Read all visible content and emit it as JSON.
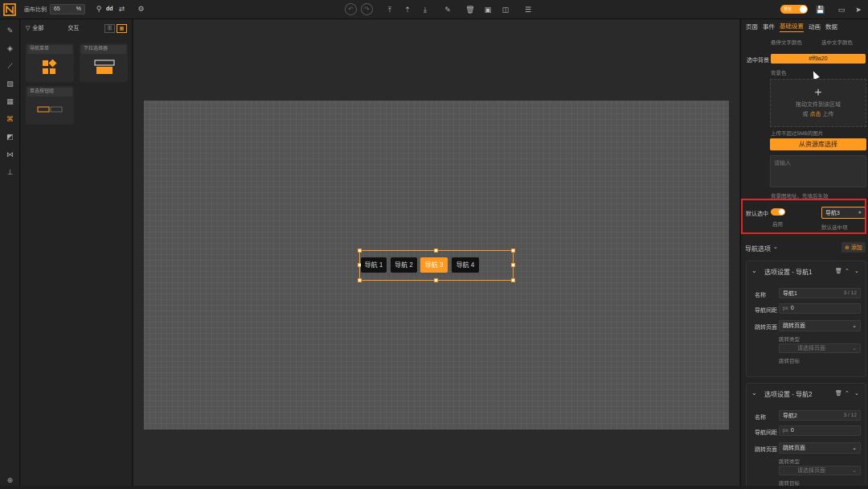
{
  "topbar": {
    "ratio_label": "画布比例",
    "ratio_value": "65",
    "ratio_unit": "%",
    "user_name": "dd",
    "toggle_text": "预览"
  },
  "left_panel": {
    "filter_all": "全部",
    "tab_interact": "交互",
    "cards": [
      {
        "title": "导航菜单"
      },
      {
        "title": "下拉选择器"
      },
      {
        "title": "单选按钮组"
      }
    ]
  },
  "canvas": {
    "nav_buttons": [
      "导航 1",
      "导航 2",
      "导航 3",
      "导航 4"
    ],
    "selected_index": 2
  },
  "right_panel": {
    "tabs": [
      "页面",
      "事件",
      "基础设置",
      "动画",
      "数据"
    ],
    "active_tab": "基础设置",
    "col_headers": [
      "悬停文字颜色",
      "选中文字颜色"
    ],
    "selected_bg_label": "选中背景",
    "selected_bg_value": "#ff9a20",
    "bg_color_label": "背景色",
    "upload_line1": "拖动文件到该区域",
    "upload_line2_prefix": "或",
    "upload_line2_link": "点击",
    "upload_line2_suffix": "上传",
    "upload_note": "上传不超过5MB的图片",
    "from_library_button": "从资源库选择",
    "textarea_placeholder": "请输入",
    "bg_url_label": "背景图地址，先填后生效",
    "default_selected_label": "默认选中",
    "enabled_label": "启用",
    "default_value": "导航3",
    "default_value_caption": "默认选中项",
    "nav_options_label": "导航选项",
    "add_button": "添加",
    "sections": [
      {
        "title": "选项设置 - 导航1",
        "name_label": "名称",
        "name_value": "导航1",
        "name_count": "3 / 12",
        "spacing_label": "导航间距",
        "spacing_unit": "px",
        "spacing_value": "0",
        "jump_label": "跳转页面",
        "jump_value": "跳转页面",
        "jump_type_label": "跳转类型",
        "jump_select_placeholder": "请选择页面",
        "jump_target_label": "跳转目标"
      },
      {
        "title": "选项设置 - 导航2",
        "name_label": "名称",
        "name_value": "导航2",
        "name_count": "3 / 12",
        "spacing_label": "导航间距",
        "spacing_unit": "px",
        "spacing_value": "0",
        "jump_label": "跳转页面",
        "jump_value": "跳转页面",
        "jump_type_label": "跳转类型",
        "jump_select_placeholder": "请选择页面",
        "jump_target_label": "跳转目标"
      }
    ]
  },
  "colors": {
    "accent": "#ff9a20",
    "highlight": "#e0262a"
  }
}
